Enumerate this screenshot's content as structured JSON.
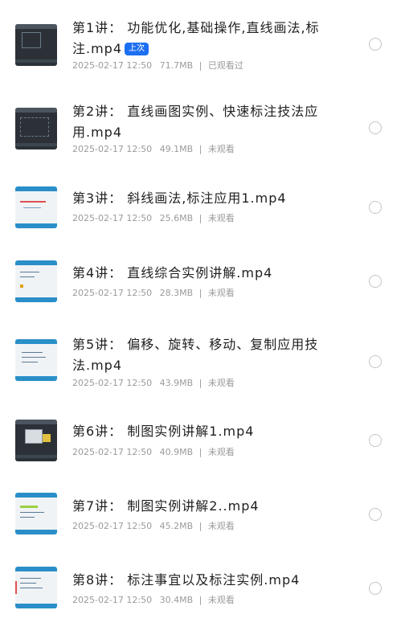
{
  "items": [
    {
      "title": "第1讲： 功能优化,基础操作,直线画法,标注.mp4",
      "badge": "上次",
      "date": "2025-02-17 12:50",
      "size": "71.7MB",
      "status": "已观看过",
      "thumb": "dark"
    },
    {
      "title": "第2讲： 直线画图实例、快速标注技法应用.mp4",
      "badge": "",
      "date": "2025-02-17 12:50",
      "size": "49.1MB",
      "status": "未观看",
      "thumb": "dark"
    },
    {
      "title": "第3讲： 斜线画法,标注应用1.mp4",
      "badge": "",
      "date": "2025-02-17 12:50",
      "size": "25.6MB",
      "status": "未观看",
      "thumb": "light"
    },
    {
      "title": "第4讲： 直线综合实例讲解.mp4",
      "badge": "",
      "date": "2025-02-17 12:50",
      "size": "28.3MB",
      "status": "未观看",
      "thumb": "light"
    },
    {
      "title": "第5讲： 偏移、旋转、移动、复制应用技法.mp4",
      "badge": "",
      "date": "2025-02-17 12:50",
      "size": "43.9MB",
      "status": "未观看",
      "thumb": "light"
    },
    {
      "title": "第6讲： 制图实例讲解1.mp4",
      "badge": "",
      "date": "2025-02-17 12:50",
      "size": "40.9MB",
      "status": "未观看",
      "thumb": "dark"
    },
    {
      "title": "第7讲： 制图实例讲解2..mp4",
      "badge": "",
      "date": "2025-02-17 12:50",
      "size": "45.2MB",
      "status": "未观看",
      "thumb": "light"
    },
    {
      "title": "第8讲： 标注事宜以及标注实例.mp4",
      "badge": "",
      "date": "2025-02-17 12:50",
      "size": "30.4MB",
      "status": "未观看",
      "thumb": "light"
    }
  ],
  "separator": "|",
  "colors": {
    "badge": "#1d6ff2",
    "meta": "#9b9b9b",
    "title": "#1f1f1f",
    "radio": "#c4c4c4"
  }
}
